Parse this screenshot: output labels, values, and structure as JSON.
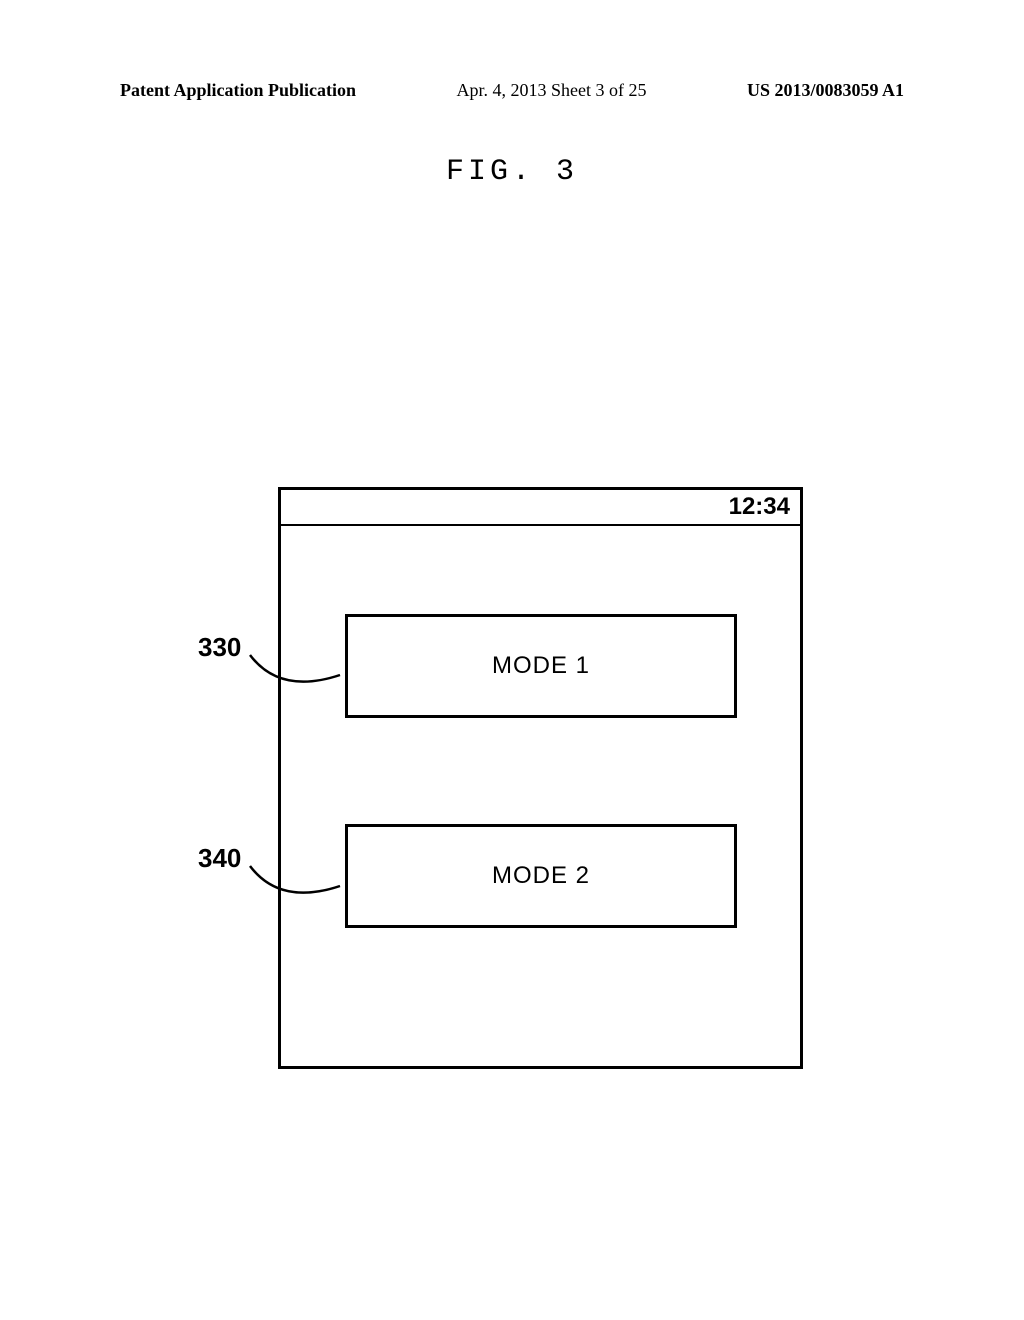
{
  "header": {
    "left": "Patent Application Publication",
    "center": "Apr. 4, 2013  Sheet 3 of 25",
    "right": "US 2013/0083059 A1"
  },
  "figure_title": "FIG. 3",
  "device": {
    "status_time": "12:34",
    "mode1_label": "MODE 1",
    "mode2_label": "MODE 2"
  },
  "refs": {
    "r330": "330",
    "r340": "340"
  }
}
